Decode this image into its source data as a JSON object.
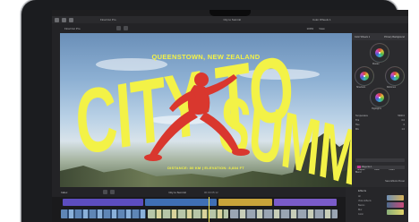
{
  "app": {
    "library_title": "Final Cut Pro",
    "project_title": "City to Summit",
    "zoom": "100%",
    "view_label": "View",
    "inspector_title": "Color Wheels 1",
    "inspector_right": "Primary Background"
  },
  "viewer": {
    "place": "QUEENSTOWN, NEW ZEALAND",
    "title_city": "CITY TO",
    "title_to": "",
    "title_summit": "SUMMIT",
    "distance": "DISTANCE: 80 KM | ELEVATION: 8,884 FT"
  },
  "inspector": {
    "wheels": [
      "Master",
      "Shadows",
      "Midtones",
      "Highlights"
    ],
    "rows": [
      "Temperature",
      "Tint",
      "Hue",
      "Mix"
    ],
    "row_values": [
      "5000.0",
      "0.0",
      "0",
      "1.0"
    ],
    "mask_labels": [
      "Shapes",
      "Color",
      "Invert"
    ],
    "mask_rows": [
      "Magenta 1",
      "Blend"
    ],
    "save_label": "Save Effects Preset"
  },
  "timeline": {
    "index_label": "Index",
    "project_label": "City to Summit",
    "timecode": "00:00:05:12"
  },
  "effects": {
    "title": "Effects",
    "categories": [
      "All",
      "Video Effects",
      "Basics",
      "Blur",
      "Color"
    ]
  },
  "colors": {
    "accent_yellow": "#f3f247",
    "subject_red": "#d9372e",
    "ui_dark": "#1e1e20"
  }
}
